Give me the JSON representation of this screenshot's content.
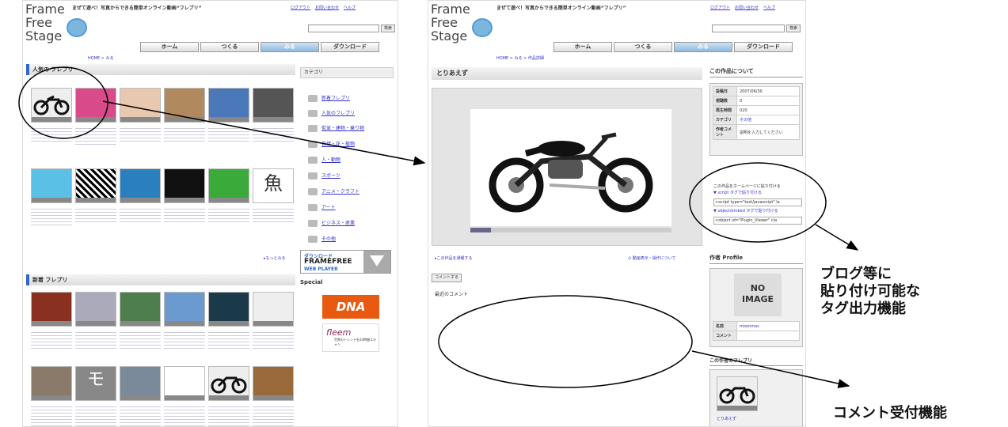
{
  "left": {
    "logo": [
      "Frame",
      "Free",
      "Stage"
    ],
    "tagline": "まぜて遊べ！写真からできる簡単オンライン動画“フレプリ”",
    "toplinks": [
      "ログアウト",
      "お問い合わせ",
      "ヘルプ"
    ],
    "search_button": "検索",
    "nav": [
      "ホーム",
      "つくる",
      "みる",
      "ダウンロード"
    ],
    "breadcrumb": "HOME > みる",
    "popular_title": "人気の フレプリ",
    "new_title": "新着 フレプリ",
    "category_title": "カテゴリ",
    "categories": [
      "新着フレプリ",
      "人気のフレプリ",
      "街並・建物・乗り物",
      "自然・花・植物",
      "人・動物",
      "スポーツ",
      "アニメ・クラフト",
      "アート",
      "ビジネス・産業",
      "その他"
    ],
    "more": "▸もっとみる",
    "download_banner": [
      "ダウンロード",
      "FRAMEFREE",
      "WEB PLAYER"
    ],
    "special": "Special",
    "dna": "DNA",
    "fleem": "fleem",
    "fleem_sub": "世界のトレンドを24時間スキャン",
    "thumb_texts": [
      "魚",
      "モ"
    ]
  },
  "right": {
    "logo": [
      "Frame",
      "Free",
      "Stage"
    ],
    "tagline": "まぜて遊べ！写真からできる簡単オンライン動画“フレプリ”",
    "toplinks": [
      "ログアウト",
      "お問い合わせ",
      "ヘルプ"
    ],
    "search_button": "検索",
    "nav": [
      "ホーム",
      "つくる",
      "みる",
      "ダウンロード"
    ],
    "breadcrumb": "HOME > みる > 作品詳細",
    "work_title": "とりあえず",
    "link_left": "▸この作品を通報する",
    "link_right": "⊙ 動画表示・操作について",
    "comment_button": "コメントする",
    "recent_comments": "最近のコメント",
    "about_title": "この作品について",
    "about_rows": [
      {
        "k": "投稿日",
        "v": "2007/06/30"
      },
      {
        "k": "視聴数",
        "v": "0"
      },
      {
        "k": "再生時間",
        "v": "020"
      },
      {
        "k": "カテゴリ",
        "v": "その他"
      },
      {
        "k": "作者コメント",
        "v": "説明を入力してください"
      }
    ],
    "embed_intro": "この作品をホームページに貼り付ける",
    "script_label": "▼ script タグで貼り付ける",
    "script_code": "<script type=\"text/javascript\" la",
    "object_label": "▼ object/embed タグで貼り付ける",
    "object_code": "<object id=\"Plugin_Viewer\" cla",
    "profile_title": "作者 Profile",
    "no_image": "NO IMAGE",
    "profile_rows": [
      {
        "k": "名前",
        "v": "moonmas"
      },
      {
        "k": "コメント",
        "v": ""
      }
    ],
    "author_works_title": "この作者のフレプリ",
    "author_work_caption": "とりあえず"
  },
  "annotations": {
    "tag_output": [
      "ブログ等に",
      "貼り付け可能な",
      "タグ出力機能"
    ],
    "comment_function": "コメント受付機能"
  }
}
